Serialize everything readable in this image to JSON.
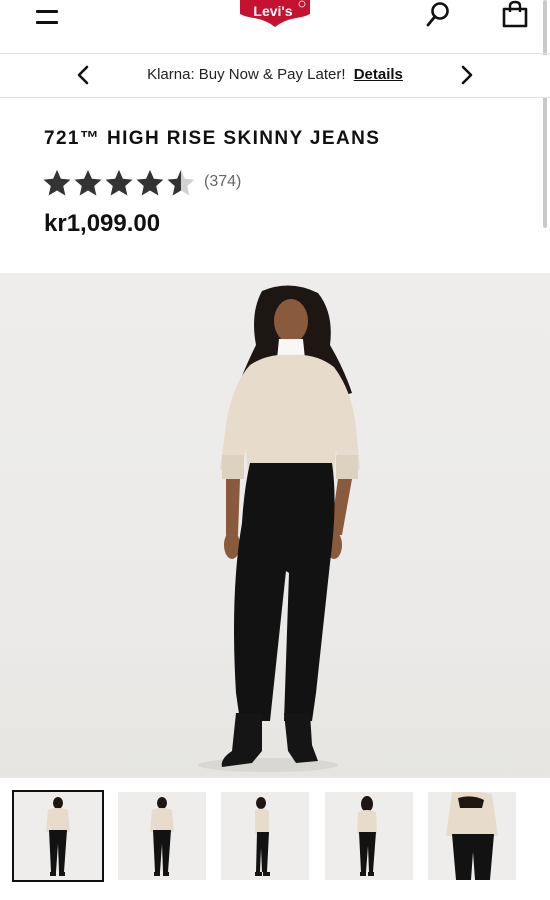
{
  "header": {
    "menu_icon": "hamburger-menu-icon",
    "logo_text": "Levi's",
    "logo_registered": "®",
    "search_icon": "search-icon",
    "bag_icon": "shopping-bag-icon"
  },
  "promo": {
    "text": "Klarna: Buy Now & Pay Later!",
    "link": "Details",
    "prev_icon": "chevron-left-icon",
    "next_icon": "chevron-right-icon"
  },
  "product": {
    "title": "721™ HIGH RISE SKINNY JEANS",
    "rating": 4.5,
    "rating_max": 5,
    "review_count": "(374)",
    "price": "kr1,099.00"
  },
  "gallery": {
    "thumbnail_count": 5,
    "selected_index": 0,
    "thumbnails": [
      "front view",
      "front view",
      "side view",
      "back view",
      "back close-up"
    ]
  },
  "colors": {
    "brand_red": "#c41230",
    "star": "#333333",
    "star_empty": "#d2d2d2",
    "sweater": "#e7dccb",
    "jeans": "#121212"
  }
}
